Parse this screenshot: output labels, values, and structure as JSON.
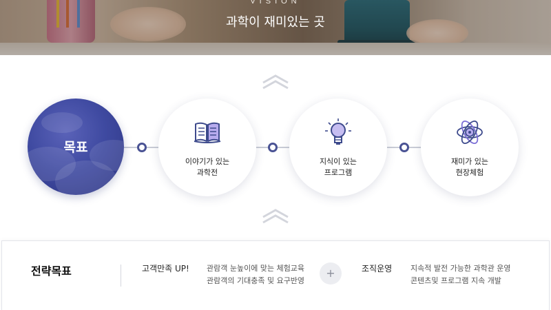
{
  "hero": {
    "tag": "VISION",
    "title": "과학이 재미있는 곳"
  },
  "goal": {
    "label": "목표",
    "color": "#3f4aa1"
  },
  "features": [
    {
      "icon": "open-book-icon",
      "line1": "이야기가 있는",
      "line2": "과학전"
    },
    {
      "icon": "lightbulb-icon",
      "line1": "지식이 있는",
      "line2": "프로그램"
    },
    {
      "icon": "atom-icon",
      "line1": "재미가 있는",
      "line2": "현장체험"
    }
  ],
  "strategy": {
    "title": "전략목표",
    "items": [
      {
        "head": "고객만족 UP!",
        "desc1": "관람객 눈높이에 맞는 체험교육",
        "desc2": "관람객의 기대충족 및 요구반영"
      },
      {
        "head": "조직운영",
        "desc1": "지속적 발전 가능한 과학관 운영",
        "desc2": "콘텐츠및 프로그램 지속 개발"
      }
    ],
    "separator": "+"
  },
  "colors": {
    "accent": "#4a5394",
    "icon_purple": "#6b5fc9",
    "line": "#c9ccd6"
  }
}
